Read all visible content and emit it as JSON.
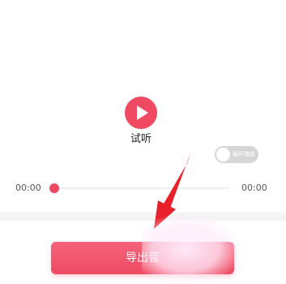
{
  "player": {
    "preview_label": "试听",
    "play_icon": "play-icon",
    "loop_label": "循环播放",
    "loop_enabled": false,
    "current_time": "00:00",
    "total_time": "00:00",
    "progress": 0
  },
  "export": {
    "button_label": "导出音"
  },
  "colors": {
    "accent": "#f04a62",
    "arrow": "#e8202a",
    "toggle_off": "#d6d6d6"
  }
}
